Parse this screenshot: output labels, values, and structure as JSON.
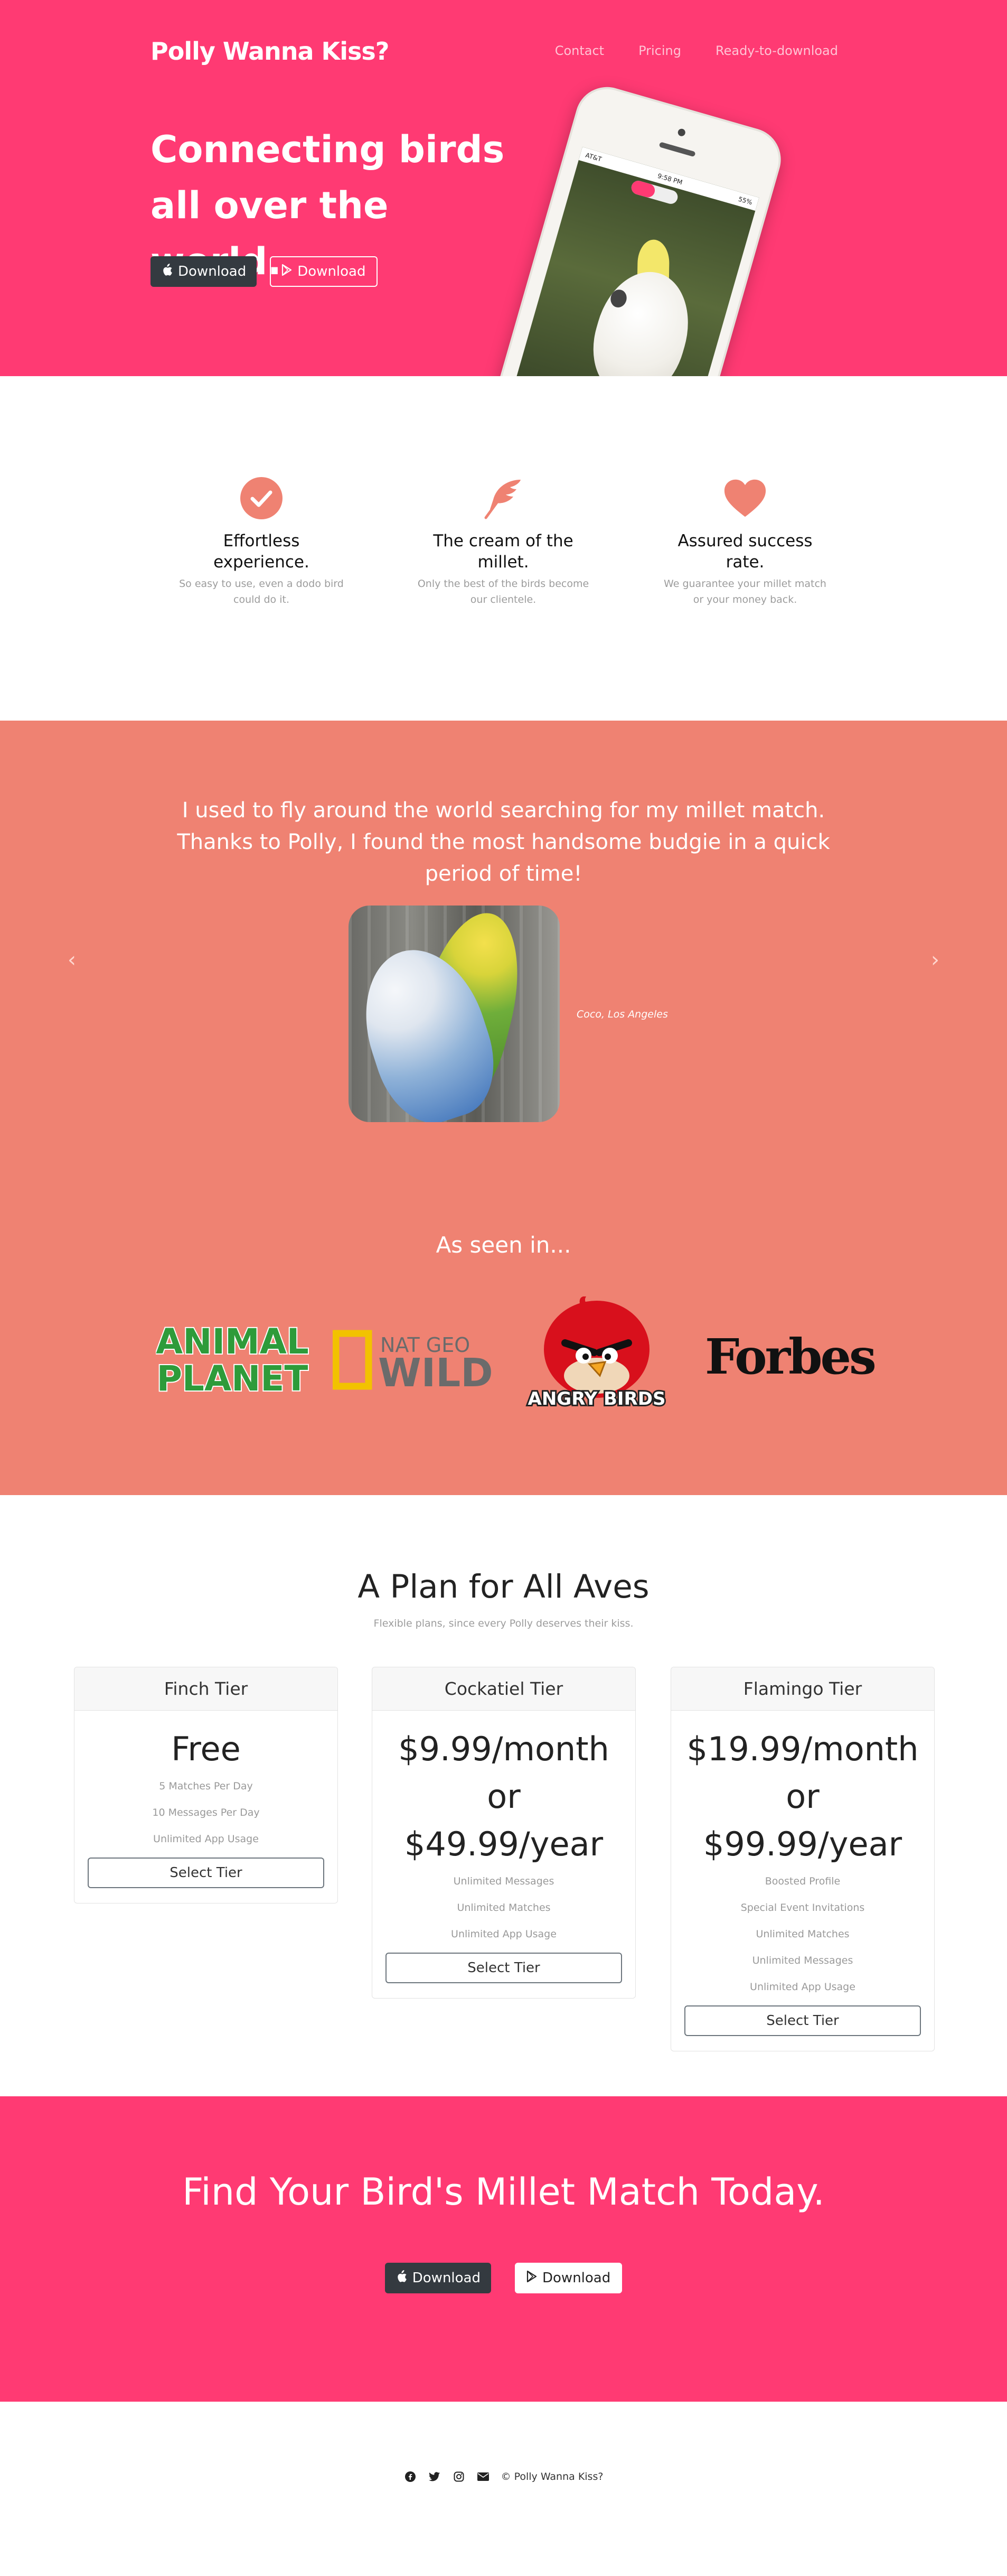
{
  "brand": "Polly Wanna Kiss?",
  "nav": {
    "contact": "Contact",
    "pricing": "Pricing",
    "download": "Ready-to-download"
  },
  "hero": {
    "title": "Connecting birds all over the world.",
    "apple_download": "Download",
    "google_download": "Download"
  },
  "phone": {
    "carrier": "AT&T",
    "time": "9:58 PM",
    "battery": "55%"
  },
  "features": [
    {
      "icon": "check-circle-icon",
      "title": "Effortless experience.",
      "text": "So easy to use, even a dodo bird could do it."
    },
    {
      "icon": "feather-icon",
      "title": "The cream of the millet.",
      "text": "Only the best of the birds become our clientele."
    },
    {
      "icon": "heart-icon",
      "title": "Assured success rate.",
      "text": "We guarantee your millet match or your money back."
    }
  ],
  "testimonial": {
    "quote": "I used to fly around the world searching for my millet match. Thanks to Polly, I found the most handsome budgie in a quick period of time!",
    "caption": "Coco, Los Angeles",
    "prev": "‹",
    "next": "›"
  },
  "seen": {
    "title": "As seen in...",
    "logos": {
      "animal_planet_1": "ANIMAL",
      "animal_planet_2": "PLANET",
      "nat_geo_1": "NAT GEO",
      "nat_geo_2": "WILD",
      "angry_birds": "ANGRY BIRDS",
      "forbes": "Forbes"
    }
  },
  "pricing": {
    "title": "A Plan for All Aves",
    "subtitle": "Flexible plans, since every Polly deserves their kiss.",
    "tiers": [
      {
        "name": "Finch Tier",
        "price": "Free",
        "price2": "",
        "features": [
          "5 Matches Per Day",
          "10 Messages Per Day",
          "Unlimited App Usage"
        ],
        "button": "Select Tier"
      },
      {
        "name": "Cockatiel Tier",
        "price": "$9.99/month",
        "price2": "or $49.99/year",
        "features": [
          "Unlimited Messages",
          "Unlimited Matches",
          "Unlimited App Usage"
        ],
        "button": "Select Tier"
      },
      {
        "name": "Flamingo Tier",
        "price": "$19.99/month",
        "price2": "or $99.99/year",
        "features": [
          "Boosted Profile",
          "Special Event Invitations",
          "Unlimited Matches",
          "Unlimited Messages",
          "Unlimited App Usage"
        ],
        "button": "Select Tier"
      }
    ]
  },
  "cta": {
    "title": "Find Your Bird's Millet Match Today.",
    "apple_download": "Download",
    "google_download": "Download"
  },
  "footer": {
    "copyright": "© Polly Wanna Kiss?"
  },
  "colors": {
    "pink": "#ff3a73",
    "salmon": "#ef8272",
    "dark": "#343a40"
  }
}
